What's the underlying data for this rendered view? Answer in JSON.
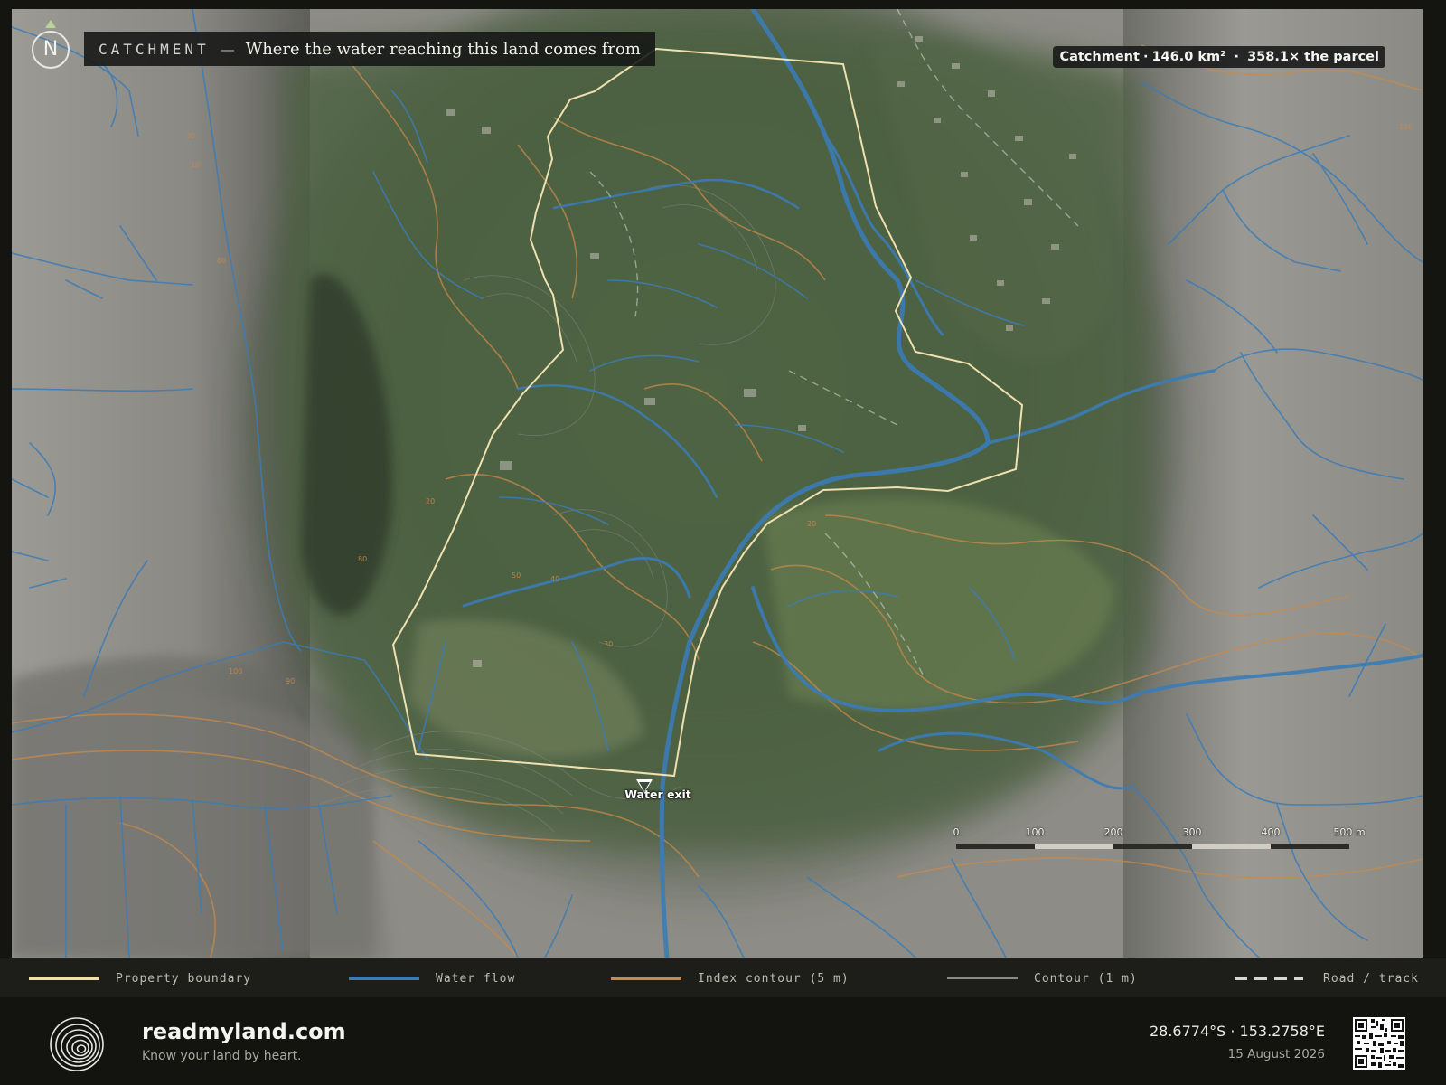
{
  "map": {
    "title_kicker": "CATCHMENT",
    "title_dash": "—",
    "title_text": "Where the water reaching this land comes from",
    "north_label": "N",
    "stat": {
      "label": "Catchment",
      "area": "146.0 km²",
      "ratio": "358.1× the parcel"
    },
    "exit_label": "Water exit",
    "scale_ticks": [
      "0",
      "100",
      "200",
      "300",
      "400",
      "500 m"
    ],
    "contour_labels": [
      "20",
      "80",
      "100",
      "90",
      "50",
      "40",
      "30",
      "20",
      "80",
      "30",
      "120",
      "10"
    ]
  },
  "colors": {
    "boundary": "#efe0b0",
    "water": "#3b7cb6",
    "index_contour": "#c98a4a",
    "contour": "#8b8b86",
    "road": "#d8d8d2"
  },
  "legend": [
    {
      "label": "Property boundary",
      "type": "boundary"
    },
    {
      "label": "Water flow",
      "type": "water"
    },
    {
      "label": "Index contour (5 m)",
      "type": "index"
    },
    {
      "label": "Contour (1 m)",
      "type": "contour"
    },
    {
      "label": "Road / track",
      "type": "road"
    }
  ],
  "footer": {
    "brand": "readmyland.com",
    "tagline": "Know your land by heart.",
    "coords": "28.6774°S · 153.2758°E",
    "date": "15 August 2026",
    "logo_icon": "concentric-rings-icon",
    "qr_icon": "qr-code-icon"
  }
}
